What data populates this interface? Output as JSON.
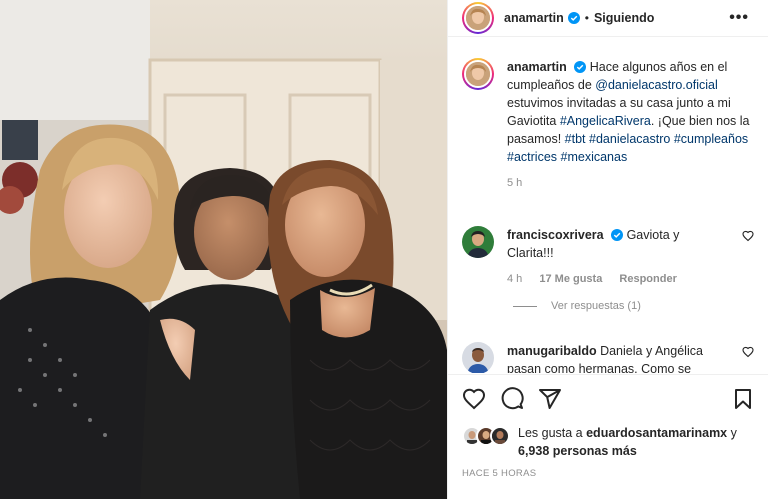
{
  "post": {
    "username": "anamartin",
    "separator": "•",
    "follow_status": "Siguiendo",
    "more_icon": "more-options-icon",
    "caption": {
      "username": "anamartin",
      "part1": "Hace algunos años en el cumpleaños de ",
      "mention": "@danielacastro.oficial",
      "part2": " estuvimos invitadas a su casa junto a mi Gaviotita ",
      "tag1": "#AngelicaRivera",
      "part3": ". ¡Que bien nos la pasamos! ",
      "tag2": "#tbt",
      "tag3": "#danielacastro",
      "tag4": "#cumpleaños",
      "tag5": "#actrices",
      "tag6": "#mexicanas",
      "time": "5 h"
    },
    "comments": [
      {
        "username": "franciscoxrivera",
        "text": "Gaviota y Clarita!!!",
        "time": "4 h",
        "likes": "17 Me gusta",
        "reply": "Responder",
        "view_replies": "Ver respuestas (1)"
      },
      {
        "username": "manugaribaldo",
        "text": "Daniela y Angélica pasan como hermanas. Como se"
      }
    ],
    "likes": {
      "prefix": "Les gusta a ",
      "user": "eduardosantamarinamx",
      "middle": " y",
      "count": "6,938 personas más"
    },
    "posted_ago": "HACE 5 HORAS"
  },
  "colors": {
    "text": "#262626",
    "secondary": "#8e8e8e",
    "link": "#00376b",
    "verified": "#0095f6",
    "border": "#efefef"
  }
}
